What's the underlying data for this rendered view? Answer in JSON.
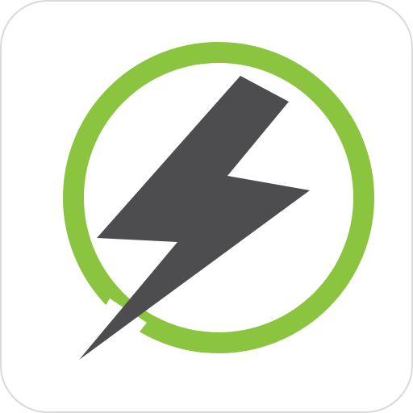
{
  "icon": {
    "name": "lightning-bolt-in-ring",
    "ring_color": "#8BC540",
    "bolt_color": "#4D4D4F",
    "tile_color": "#FFFFFF",
    "tile_edge_color": "#D9D9D9"
  }
}
